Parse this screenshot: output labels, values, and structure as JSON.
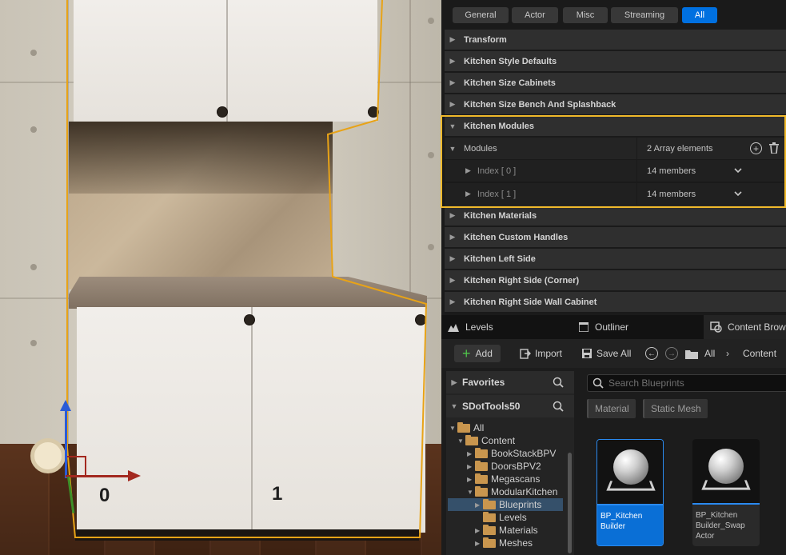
{
  "details": {
    "filters": [
      "General",
      "Actor",
      "Misc",
      "Streaming",
      "All"
    ],
    "active_filter": "All",
    "categories_top": [
      "Transform",
      "Kitchen Style Defaults",
      "Kitchen Size Cabinets",
      "Kitchen Size Bench And Splashback"
    ],
    "modules_category": "Kitchen Modules",
    "modules_property": {
      "label": "Modules",
      "value": "2 Array elements",
      "items": [
        {
          "label": "Index [ 0 ]",
          "value": "14 members"
        },
        {
          "label": "Index [ 1 ]",
          "value": "14 members"
        }
      ]
    },
    "categories_bottom": [
      "Kitchen Materials",
      "Kitchen Custom Handles",
      "Kitchen Left Side",
      "Kitchen Right Side (Corner)",
      "Kitchen Right Side Wall Cabinet"
    ]
  },
  "tabs": [
    "Levels",
    "Outliner",
    "Content Brow"
  ],
  "content_browser": {
    "toolbar": {
      "add": "Add",
      "import": "Import",
      "save_all": "Save All",
      "path": [
        "All",
        "Content"
      ]
    },
    "favorites": "Favorites",
    "project": "SDotTools50",
    "tree": [
      {
        "label": "All",
        "level": 0
      },
      {
        "label": "Content",
        "level": 1
      },
      {
        "label": "BookStackBPV",
        "level": 2
      },
      {
        "label": "DoorsBPV2",
        "level": 2
      },
      {
        "label": "Megascans",
        "level": 2
      },
      {
        "label": "ModularKitchen",
        "level": 2
      },
      {
        "label": "Blueprints",
        "level": 3
      },
      {
        "label": "Levels",
        "level": 3
      },
      {
        "label": "Materials",
        "level": 3
      },
      {
        "label": "Meshes",
        "level": 3
      }
    ],
    "search_placeholder": "Search Blueprints",
    "filter_chips": [
      "Material",
      "Static Mesh"
    ],
    "assets": [
      {
        "name": "BP_Kitchen Builder",
        "selected": true
      },
      {
        "name": "BP_Kitchen Builder_Swap Actor",
        "selected": false
      }
    ]
  },
  "viewport": {
    "cabinet_labels": [
      "0",
      "1"
    ]
  },
  "colors": {
    "accent": "#0070e0",
    "highlight": "#f0b92a",
    "selection_outline": "#e8a317"
  }
}
